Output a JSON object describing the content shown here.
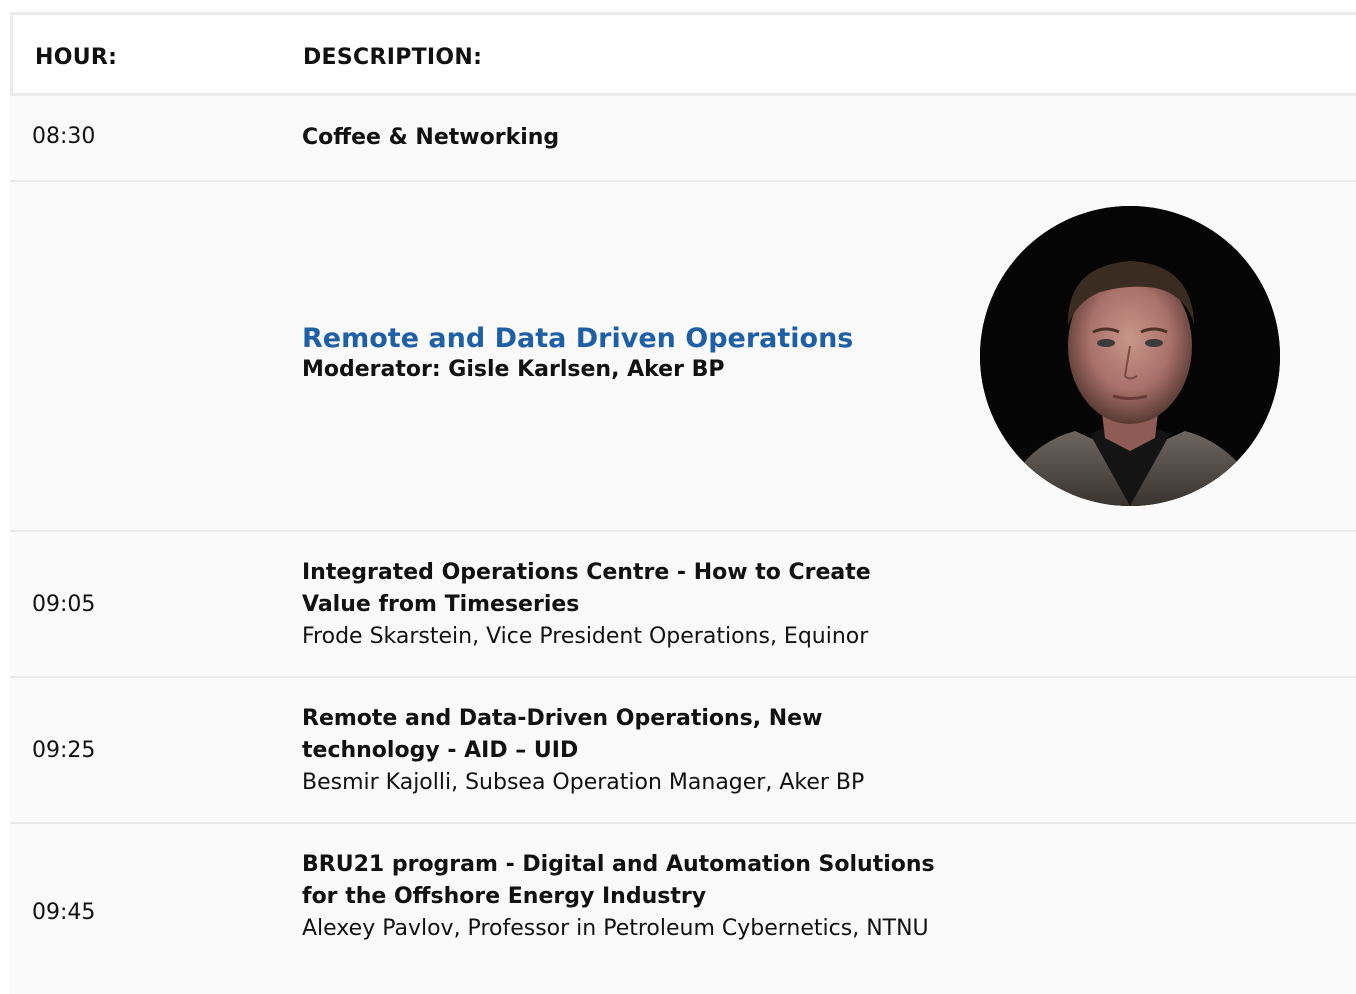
{
  "header": {
    "hour_label": "HOUR:",
    "description_label": "DESCRIPTION:"
  },
  "rows": [
    {
      "hour": "08:30",
      "title": "Coffee & Networking"
    },
    {
      "hour": "",
      "session_title": "Remote and Data Driven Operations",
      "moderator": "Moderator: Gisle Karlsen, Aker BP",
      "avatar_icon": "moderator-portrait"
    },
    {
      "hour": "09:05",
      "title": "Integrated Operations Centre - How to Create Value from Timeseries",
      "speaker": "Frode Skarstein, Vice President Operations, Equinor"
    },
    {
      "hour": "09:25",
      "title": "Remote and Data-Driven Operations, New technology - AID – UID",
      "speaker": "Besmir Kajolli, Subsea Operation Manager, Aker BP"
    },
    {
      "hour": "09:45",
      "title": "BRU21 program - Digital and Automation Solutions for the Offshore Energy Industry",
      "speaker": "Alexey Pavlov, Professor in Petroleum Cybernetics, NTNU"
    }
  ],
  "colors": {
    "session_title": "#1f5fa5",
    "row_background": "#fafafa",
    "divider": "#e9e9e9"
  }
}
